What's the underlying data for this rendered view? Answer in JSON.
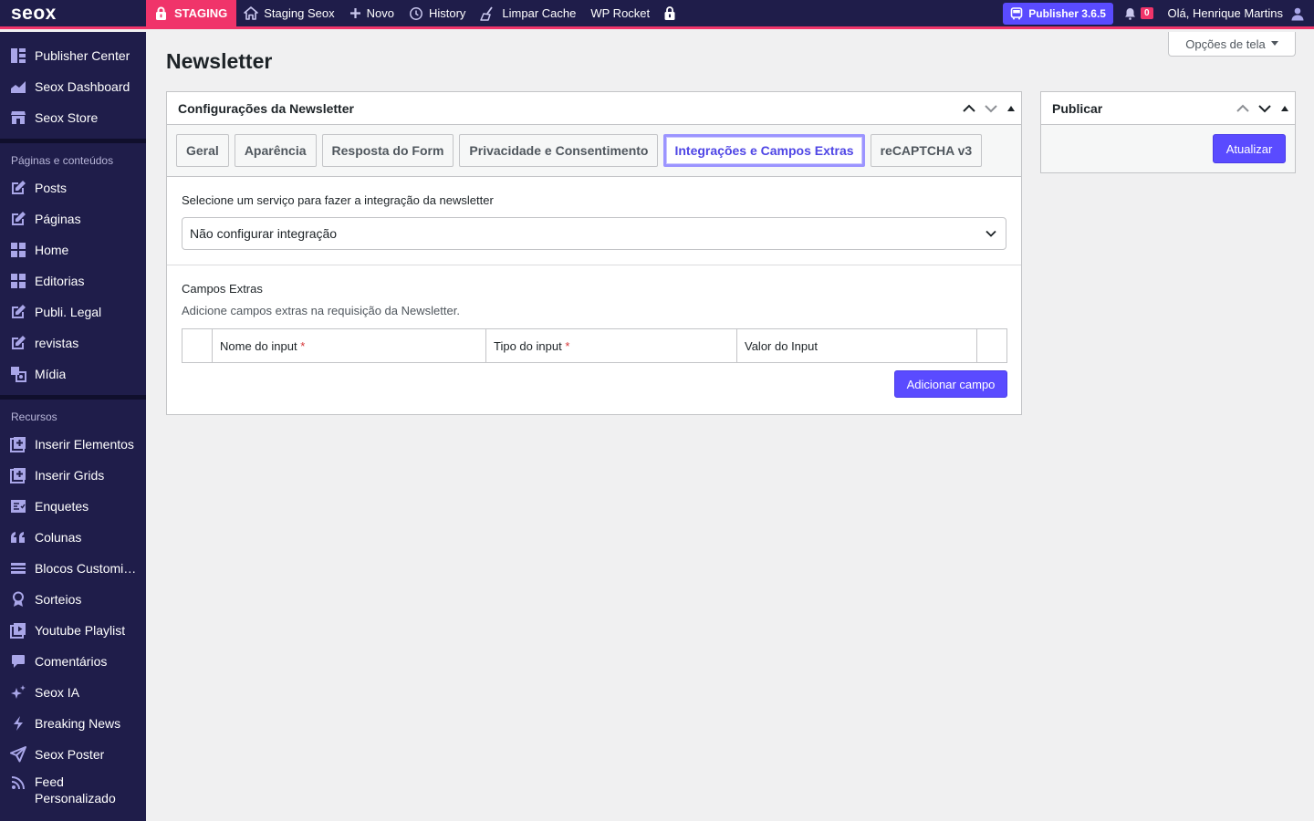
{
  "adminbar": {
    "logo": "seox",
    "staging": "STAGING",
    "site": "Staging Seox",
    "novo": "Novo",
    "history": "History",
    "cache": "Limpar Cache",
    "rocket": "WP Rocket",
    "publisher": "Publisher 3.6.5",
    "notifications": "0",
    "howdy": "Olá, Henrique Martins",
    "accent": "#f0346a",
    "bar_bg": "#1f1d4a"
  },
  "sidebar": {
    "top_items": [
      {
        "label": "Publisher Center",
        "icon": "grid-layout-icon"
      },
      {
        "label": "Seox Dashboard",
        "icon": "chart-area-icon"
      },
      {
        "label": "Seox Store",
        "icon": "store-icon"
      }
    ],
    "heading_content": "Páginas e conteúdos",
    "content_items": [
      {
        "label": "Posts",
        "icon": "edit-icon"
      },
      {
        "label": "Páginas",
        "icon": "edit-icon"
      },
      {
        "label": "Home",
        "icon": "blocks-icon"
      },
      {
        "label": "Editorias",
        "icon": "blocks-icon"
      },
      {
        "label": "Publi. Legal",
        "icon": "edit-icon"
      },
      {
        "label": "revistas",
        "icon": "edit-icon"
      },
      {
        "label": "Mídia",
        "icon": "media-icon"
      }
    ],
    "heading_resources": "Recursos",
    "resource_items": [
      {
        "label": "Inserir Elementos",
        "icon": "plus-square-icon"
      },
      {
        "label": "Inserir Grids",
        "icon": "plus-grid-icon"
      },
      {
        "label": "Enquetes",
        "icon": "poll-icon"
      },
      {
        "label": "Colunas",
        "icon": "quote-icon"
      },
      {
        "label": "Blocos Customizados",
        "icon": "blocks-list-icon"
      },
      {
        "label": "Sorteios",
        "icon": "award-icon"
      },
      {
        "label": "Youtube Playlist",
        "icon": "playlist-icon"
      },
      {
        "label": "Comentários",
        "icon": "comment-icon"
      },
      {
        "label": "Seox IA",
        "icon": "sparkle-icon"
      },
      {
        "label": "Breaking News",
        "icon": "bolt-icon"
      },
      {
        "label": "Seox Poster",
        "icon": "send-icon"
      },
      {
        "label": "Feed Personalizado",
        "icon": "rss-icon"
      }
    ]
  },
  "screen_options": "Opções de tela",
  "page_title": "Newsletter",
  "settings_box": {
    "title": "Configurações da Newsletter",
    "tabs": [
      "Geral",
      "Aparência",
      "Resposta do Form",
      "Privacidade e Consentimento",
      "Integrações e Campos Extras",
      "reCAPTCHA v3"
    ],
    "active_tab": "Integrações e Campos Extras",
    "integration_label": "Selecione um serviço para fazer a integração da newsletter",
    "integration_value": "Não configurar integração",
    "extra_title": "Campos Extras",
    "extra_desc": "Adicione campos extras na requisição da Newsletter.",
    "columns": [
      "Nome do input",
      "Tipo do input",
      "Valor do Input"
    ],
    "required_mark": "*",
    "add_button": "Adicionar campo"
  },
  "publish_box": {
    "title": "Publicar",
    "update_button": "Atualizar"
  },
  "colors": {
    "primary": "#5a4bff",
    "active_tab_text": "#4f46e5"
  }
}
